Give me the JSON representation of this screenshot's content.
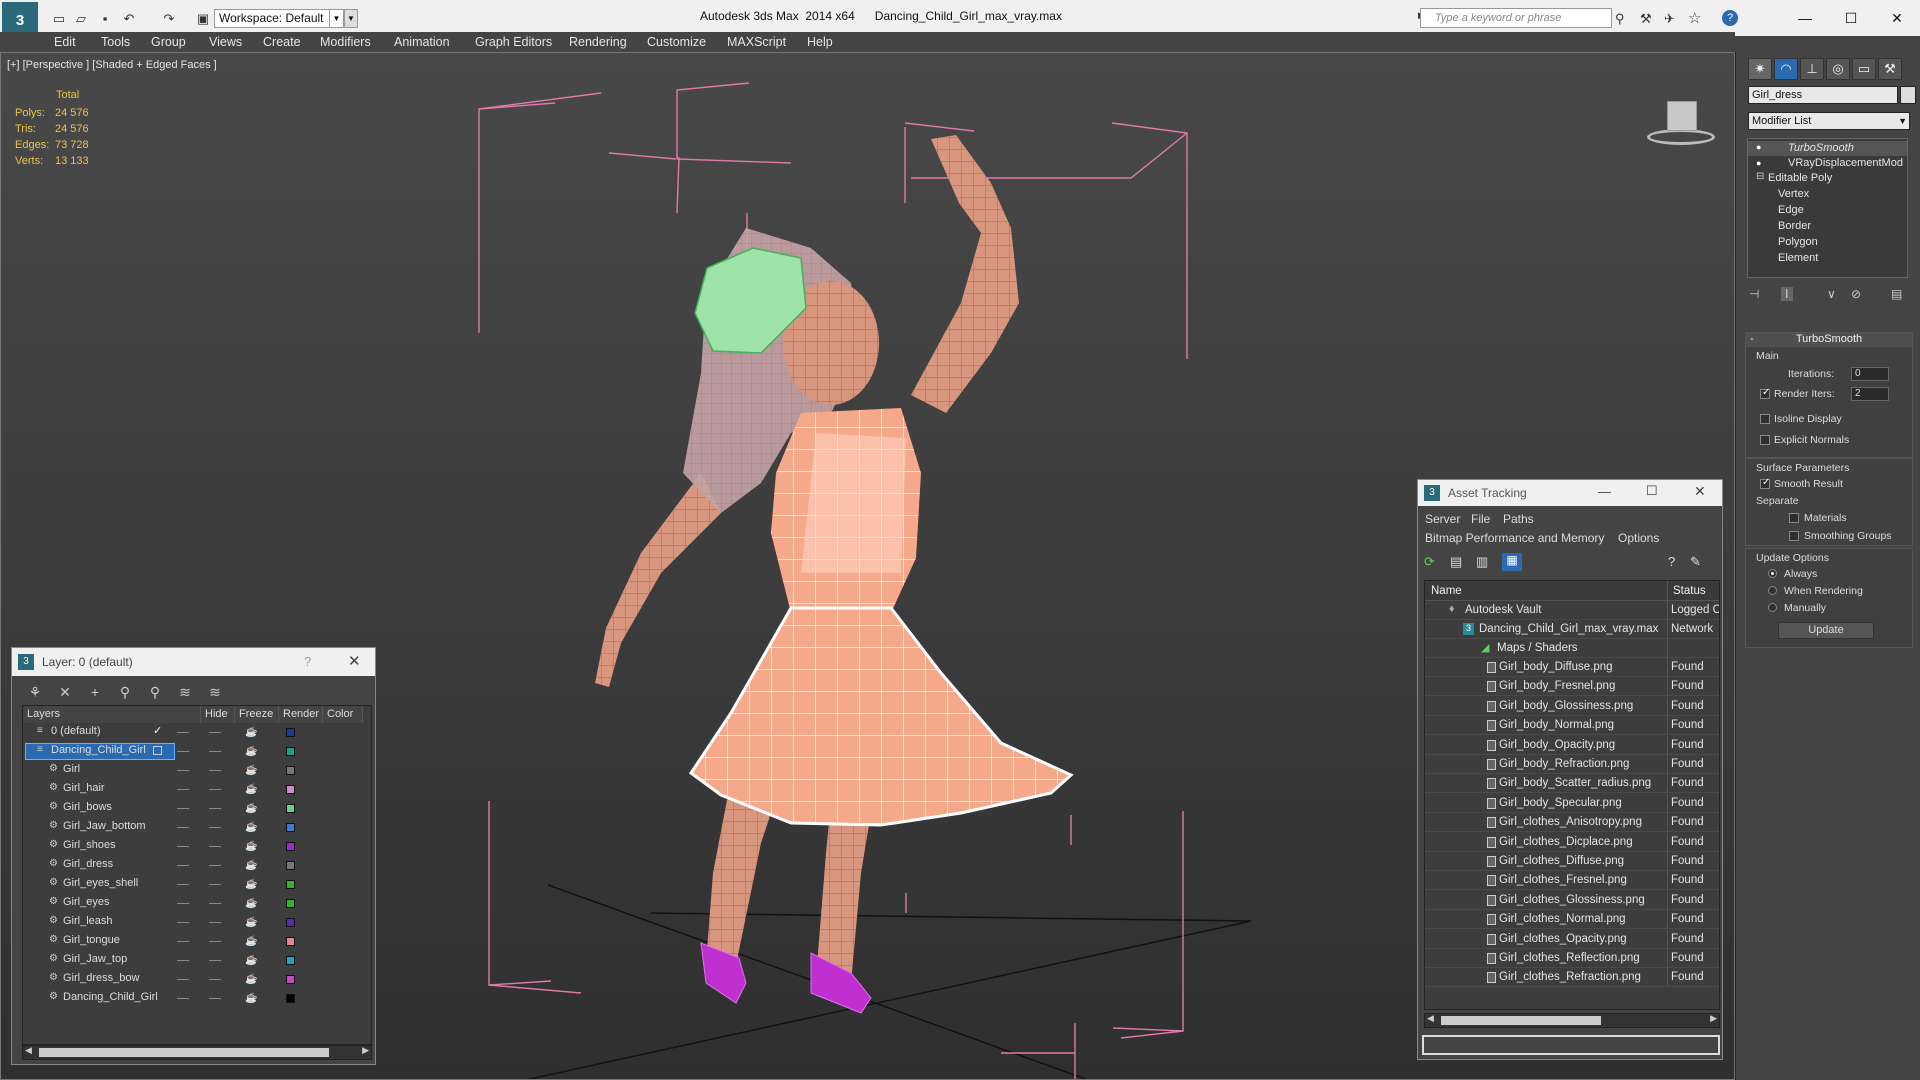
{
  "titlebar": {
    "app_name": "Autodesk 3ds Max  2014 x64",
    "file_name": "Dancing_Child_Girl_max_vray.max",
    "workspace": "Workspace: Default",
    "search_placeholder": "Type a keyword or phrase"
  },
  "menu": [
    "Edit",
    "Tools",
    "Group",
    "Views",
    "Create",
    "Modifiers",
    "Animation",
    "Graph Editors",
    "Rendering",
    "Customize",
    "MAXScript",
    "Help"
  ],
  "viewport": {
    "label": "[+] [Perspective ] [Shaded + Edged Faces ]",
    "stats_header": "Total",
    "stats": [
      {
        "label": "Polys:",
        "value": "24 576"
      },
      {
        "label": "Tris:",
        "value": "24 576"
      },
      {
        "label": "Edges:",
        "value": "73 728"
      },
      {
        "label": "Verts:",
        "value": "13 133"
      }
    ]
  },
  "command_panel": {
    "object_name": "Girl_dress",
    "modifier_list": "Modifier List",
    "stack": [
      "TurboSmooth",
      "VRayDisplacementMod",
      "Editable Poly",
      "Vertex",
      "Edge",
      "Border",
      "Polygon",
      "Element"
    ],
    "rollout_title": "TurboSmooth",
    "main_label": "Main",
    "iterations_label": "Iterations:",
    "iterations_value": "0",
    "render_iters_label": "Render Iters:",
    "render_iters_value": "2",
    "isoline": "Isoline Display",
    "explicit_normals": "Explicit Normals",
    "surface_params": "Surface Parameters",
    "smooth_result": "Smooth Result",
    "separate": "Separate",
    "materials": "Materials",
    "smoothing_groups": "Smoothing Groups",
    "update_options": "Update Options",
    "always": "Always",
    "when_rendering": "When Rendering",
    "manually": "Manually",
    "update_button": "Update"
  },
  "layer_window": {
    "title": "Layer: 0 (default)",
    "columns": [
      "Layers",
      "Hide",
      "Freeze",
      "Render",
      "Color"
    ],
    "rows": [
      {
        "name": "0 (default)",
        "color": "#1a3a9a"
      },
      {
        "name": "Dancing_Child_Girl",
        "color": "#1aa08a"
      },
      {
        "name": "Girl",
        "color": "#777777"
      },
      {
        "name": "Girl_hair",
        "color": "#d08ad0"
      },
      {
        "name": "Girl_bows",
        "color": "#6ad08a"
      },
      {
        "name": "Girl_Jaw_bottom",
        "color": "#3a7ad0"
      },
      {
        "name": "Girl_shoes",
        "color": "#9a2ad0"
      },
      {
        "name": "Girl_dress",
        "color": "#777777"
      },
      {
        "name": "Girl_eyes_shell",
        "color": "#3ab02a"
      },
      {
        "name": "Girl_eyes",
        "color": "#3ab02a"
      },
      {
        "name": "Girl_leash",
        "color": "#5a2ab0"
      },
      {
        "name": "Girl_tongue",
        "color": "#e08a8a"
      },
      {
        "name": "Girl_Jaw_top",
        "color": "#2aa0c0"
      },
      {
        "name": "Girl_dress_bow",
        "color": "#c04ac0"
      },
      {
        "name": "Dancing_Child_Girl",
        "color": "#000000"
      }
    ]
  },
  "asset_window": {
    "title": "Asset Tracking",
    "menu1": [
      "Server",
      "File",
      "Paths"
    ],
    "menu2": [
      "Bitmap Performance and Memory",
      "Options"
    ],
    "col_name": "Name",
    "col_status": "Status",
    "vault": {
      "name": "Autodesk Vault",
      "status": "Logged C"
    },
    "file": {
      "name": "Dancing_Child_Girl_max_vray.max",
      "status": "Network"
    },
    "maps_label": "Maps / Shaders",
    "maps": [
      {
        "name": "Girl_body_Diffuse.png",
        "status": "Found"
      },
      {
        "name": "Girl_body_Fresnel.png",
        "status": "Found"
      },
      {
        "name": "Girl_body_Glossiness.png",
        "status": "Found"
      },
      {
        "name": "Girl_body_Normal.png",
        "status": "Found"
      },
      {
        "name": "Girl_body_Opacity.png",
        "status": "Found"
      },
      {
        "name": "Girl_body_Refraction.png",
        "status": "Found"
      },
      {
        "name": "Girl_body_Scatter_radius.png",
        "status": "Found"
      },
      {
        "name": "Girl_body_Specular.png",
        "status": "Found"
      },
      {
        "name": "Girl_clothes_Anisotropy.png",
        "status": "Found"
      },
      {
        "name": "Girl_clothes_Dicplace.png",
        "status": "Found"
      },
      {
        "name": "Girl_clothes_Diffuse.png",
        "status": "Found"
      },
      {
        "name": "Girl_clothes_Fresnel.png",
        "status": "Found"
      },
      {
        "name": "Girl_clothes_Glossiness.png",
        "status": "Found"
      },
      {
        "name": "Girl_clothes_Normal.png",
        "status": "Found"
      },
      {
        "name": "Girl_clothes_Opacity.png",
        "status": "Found"
      },
      {
        "name": "Girl_clothes_Reflection.png",
        "status": "Found"
      },
      {
        "name": "Girl_clothes_Refraction.png",
        "status": "Found"
      }
    ]
  }
}
